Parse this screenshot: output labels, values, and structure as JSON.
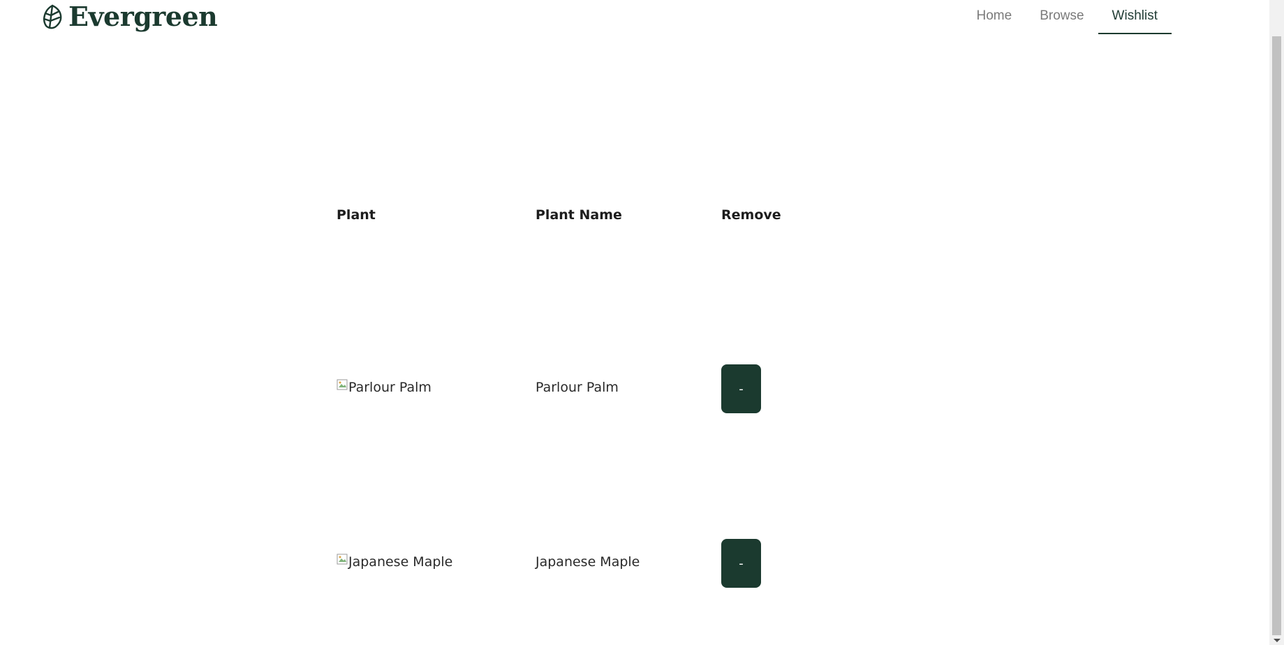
{
  "brand": {
    "name": "Evergreen",
    "color": "#1b3a2f"
  },
  "nav": {
    "items": [
      {
        "label": "Home"
      },
      {
        "label": "Browse"
      },
      {
        "label": "Wishlist"
      }
    ],
    "active": "Wishlist"
  },
  "table": {
    "headers": {
      "plant": "Plant",
      "plant_name": "Plant Name",
      "remove": "Remove"
    },
    "rows": [
      {
        "image_alt": "Parlour Palm",
        "name": "Parlour Palm",
        "remove_label": "-"
      },
      {
        "image_alt": "Japanese Maple",
        "name": "Japanese Maple",
        "remove_label": "-"
      }
    ]
  },
  "icons": {
    "logo": "leaf-logo-icon",
    "broken_image": "broken-image-icon"
  },
  "colors": {
    "accent": "#1b3a2f",
    "nav_inactive": "#7a7a7a"
  }
}
